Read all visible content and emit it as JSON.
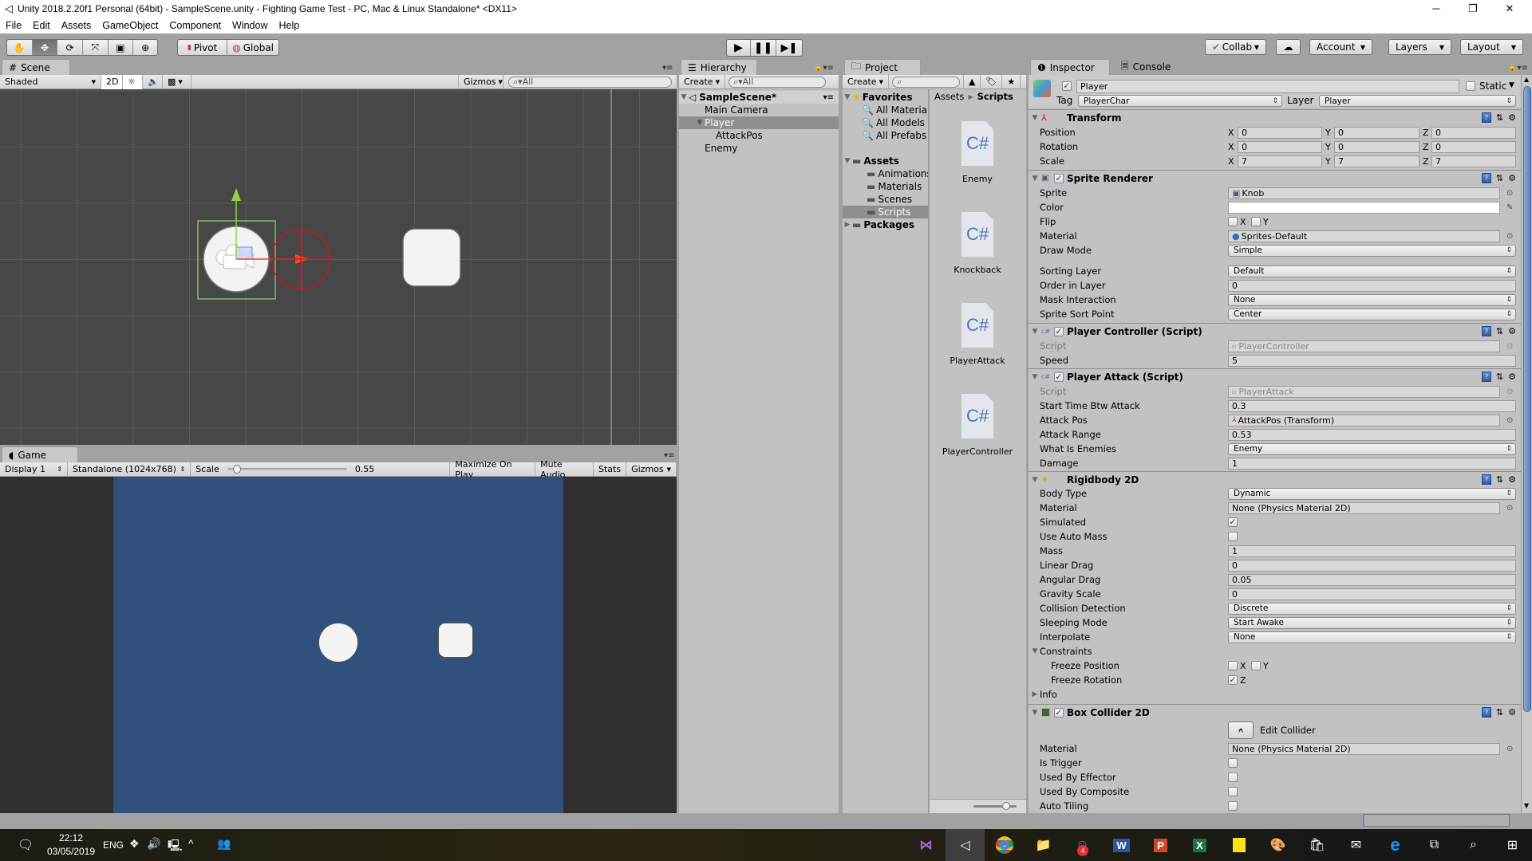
{
  "window": {
    "title": "Unity 2018.2.20f1 Personal (64bit) - SampleScene.unity - Fighting Game Test - PC, Mac & Linux Standalone* <DX11>",
    "controls": [
      "minimize",
      "restore",
      "close"
    ]
  },
  "menu": [
    "File",
    "Edit",
    "Assets",
    "GameObject",
    "Component",
    "Window",
    "Help"
  ],
  "toolbar": {
    "tools": [
      "hand-tool",
      "move-tool",
      "rotate-tool",
      "scale-tool",
      "rect-tool",
      "transform-tool"
    ],
    "active_tool": "move-tool",
    "pivot_label": "Pivot",
    "global_label": "Global",
    "collab_label": "Collab",
    "account_label": "Account",
    "layers_label": "Layers",
    "layout_label": "Layout"
  },
  "scene": {
    "tab_label": "Scene",
    "shading_mode": "Shaded",
    "mode_2d_label": "2D",
    "gizmos_label": "Gizmos",
    "search_placeholder": "All"
  },
  "game": {
    "tab_label": "Game",
    "display": "Display 1",
    "resolution": "Standalone (1024x768)",
    "scale_label": "Scale",
    "scale_value": "0.55",
    "scale_fraction": 0.05,
    "maximize_label": "Maximize On Play",
    "mute_label": "Mute Audio",
    "stats_label": "Stats",
    "gizmos_label": "Gizmos",
    "background_color": "#31507c"
  },
  "hierarchy": {
    "tab_label": "Hierarchy",
    "create_label": "Create",
    "search_placeholder": "All",
    "scene_name": "SampleScene*",
    "items": [
      {
        "label": "Main Camera",
        "depth": 1,
        "selected": false
      },
      {
        "label": "Player",
        "depth": 1,
        "selected": true,
        "expanded": true
      },
      {
        "label": "AttackPos",
        "depth": 2,
        "selected": false
      },
      {
        "label": "Enemy",
        "depth": 1,
        "selected": false
      }
    ]
  },
  "project": {
    "tab_label": "Project",
    "create_label": "Create",
    "favorites_label": "Favorites",
    "favorites": [
      "All Materials",
      "All Models",
      "All Prefabs"
    ],
    "assets_label": "Assets",
    "asset_folders": [
      "Animations",
      "Materials",
      "Scenes",
      "Scripts"
    ],
    "selected_folder": "Scripts",
    "packages_label": "Packages",
    "breadcrumb": [
      "Assets",
      "Scripts"
    ],
    "files": [
      {
        "name": "Enemy",
        "type": "C#"
      },
      {
        "name": "Knockback",
        "type": "C#"
      },
      {
        "name": "PlayerAttack",
        "type": "C#"
      },
      {
        "name": "PlayerController",
        "type": "C#"
      }
    ],
    "icon_size_fraction": 0.75
  },
  "inspector": {
    "tab_label": "Inspector",
    "console_label": "Console",
    "object_name": "Player",
    "active": true,
    "static_label": "Static",
    "static": false,
    "tag_label": "Tag",
    "tag": "PlayerChar",
    "layer_label": "Layer",
    "layer": "Player",
    "transform": {
      "title": "Transform",
      "position": {
        "label": "Position",
        "x": "0",
        "y": "0",
        "z": "0"
      },
      "rotation": {
        "label": "Rotation",
        "x": "0",
        "y": "0",
        "z": "0"
      },
      "scale": {
        "label": "Scale",
        "x": "7",
        "y": "7",
        "z": "7"
      }
    },
    "sprite_renderer": {
      "title": "Sprite Renderer",
      "sprite_label": "Sprite",
      "sprite": "Knob",
      "color_label": "Color",
      "color": "#ffffff",
      "flip_label": "Flip",
      "flip_x": false,
      "flip_y": false,
      "material_label": "Material",
      "material": "Sprites-Default",
      "draw_mode_label": "Draw Mode",
      "draw_mode": "Simple",
      "sorting_layer_label": "Sorting Layer",
      "sorting_layer": "Default",
      "order_label": "Order in Layer",
      "order": "0",
      "mask_label": "Mask Interaction",
      "mask": "None",
      "sort_point_label": "Sprite Sort Point",
      "sort_point": "Center"
    },
    "player_controller": {
      "title": "Player Controller (Script)",
      "script_label": "Script",
      "script": "PlayerController",
      "speed_label": "Speed",
      "speed": "5"
    },
    "player_attack": {
      "title": "Player Attack (Script)",
      "script_label": "Script",
      "script": "PlayerAttack",
      "start_time_label": "Start Time Btw Attack",
      "start_time": "0.3",
      "attack_pos_label": "Attack Pos",
      "attack_pos": "AttackPos (Transform)",
      "attack_range_label": "Attack Range",
      "attack_range": "0.53",
      "what_is_enemies_label": "What Is Enemies",
      "what_is_enemies": "Enemy",
      "damage_label": "Damage",
      "damage": "1"
    },
    "rigidbody2d": {
      "title": "Rigidbody 2D",
      "body_type_label": "Body Type",
      "body_type": "Dynamic",
      "material_label": "Material",
      "material": "None (Physics Material 2D)",
      "simulated_label": "Simulated",
      "simulated": true,
      "auto_mass_label": "Use Auto Mass",
      "auto_mass": false,
      "mass_label": "Mass",
      "mass": "1",
      "linear_drag_label": "Linear Drag",
      "linear_drag": "0",
      "angular_drag_label": "Angular Drag",
      "angular_drag": "0.05",
      "gravity_label": "Gravity Scale",
      "gravity": "0",
      "collision_label": "Collision Detection",
      "collision": "Discrete",
      "sleeping_label": "Sleeping Mode",
      "sleeping": "Start Awake",
      "interpolate_label": "Interpolate",
      "interpolate": "None",
      "constraints_label": "Constraints",
      "freeze_pos_label": "Freeze Position",
      "freeze_pos_x": false,
      "freeze_pos_y": false,
      "freeze_rot_label": "Freeze Rotation",
      "freeze_rot_z": true,
      "info_label": "Info"
    },
    "box_collider2d": {
      "title": "Box Collider 2D",
      "edit_collider_label": "Edit Collider",
      "material_label": "Material",
      "material": "None (Physics Material 2D)",
      "is_trigger_label": "Is Trigger",
      "is_trigger": false,
      "effector_label": "Used By Effector",
      "effector": false,
      "composite_label": "Used By Composite",
      "composite": false,
      "auto_tiling_label": "Auto Tiling",
      "auto_tiling": false
    }
  },
  "taskbar": {
    "time": "22:12",
    "date": "03/05/2019",
    "language": "ENG",
    "discord_badge": "4",
    "apps": [
      "visual-studio",
      "unity",
      "chrome",
      "file-explorer",
      "discord",
      "word",
      "powerpoint",
      "excel",
      "sticky-notes",
      "paint",
      "store",
      "mail",
      "edge",
      "task-view",
      "search",
      "start"
    ]
  }
}
